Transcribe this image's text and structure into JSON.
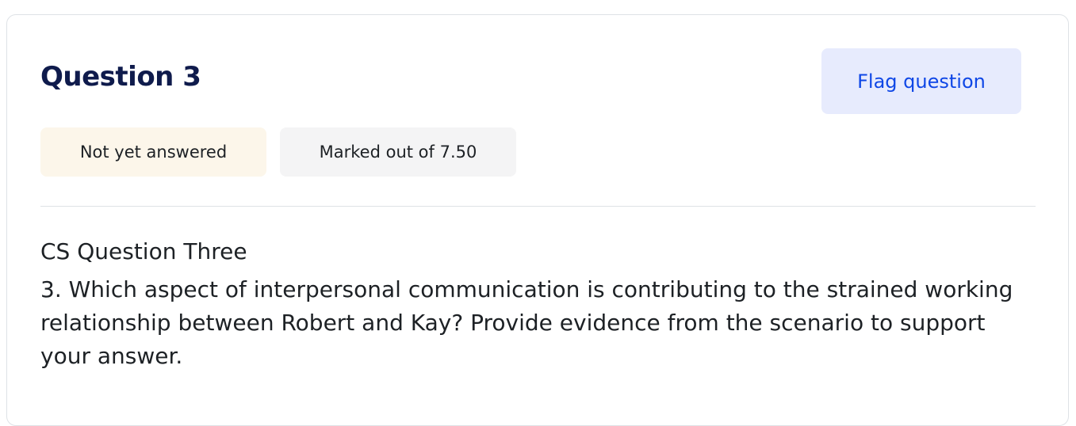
{
  "question": {
    "title": "Question 3",
    "flag_label": "Flag question",
    "status": "Not yet answered",
    "marks": "Marked out of 7.50",
    "heading": "CS Question Three",
    "text": "3. Which aspect of interpersonal communication is contributing to the strained working relationship between Robert and Kay? Provide evidence from the scenario to support your answer."
  },
  "colors": {
    "title": "#0f1b4c",
    "flag_bg": "#e7ebfd",
    "flag_text": "#0f47e6",
    "status_bg": "#fcf6ea",
    "marks_bg": "#f4f4f5",
    "border": "#dee2e6"
  },
  "icons": {
    "flag": "flag-icon"
  }
}
